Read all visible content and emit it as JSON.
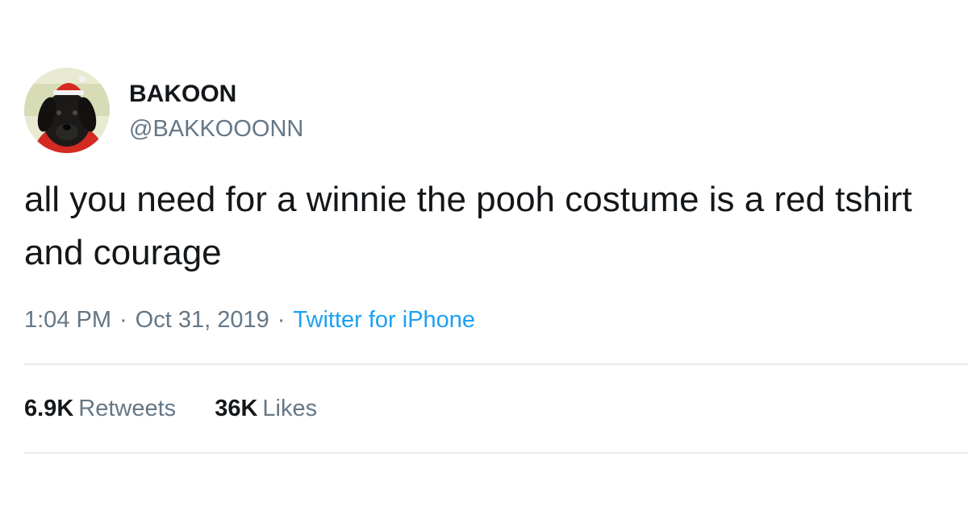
{
  "user": {
    "display_name": "BAKOON",
    "handle": "@BAKKOOONN",
    "avatar_icon": "dog-in-santa-hat-avatar"
  },
  "tweet": {
    "text": "all you need for a winnie the pooh costume is a red tshirt and courage",
    "time": "1:04 PM",
    "date": "Oct 31, 2019",
    "source": "Twitter for iPhone"
  },
  "stats": {
    "retweets_count": "6.9K",
    "retweets_label": "Retweets",
    "likes_count": "36K",
    "likes_label": "Likes"
  },
  "colors": {
    "text_primary": "#14171a",
    "text_secondary": "#657786",
    "link": "#1da1f2",
    "divider": "#e6ecf0"
  }
}
